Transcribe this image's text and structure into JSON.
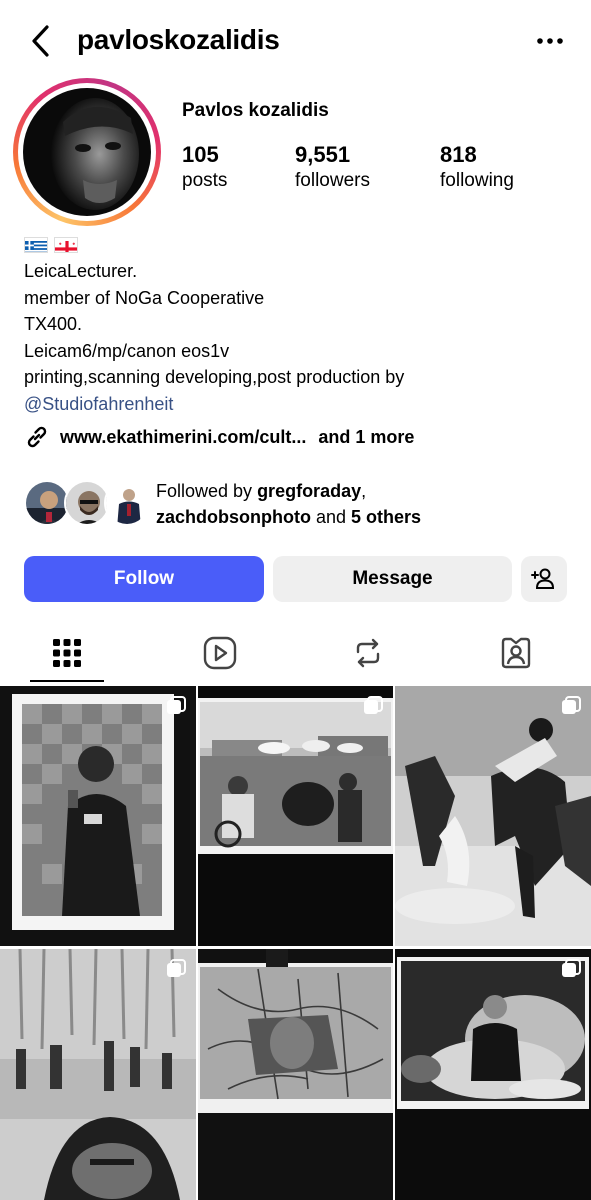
{
  "header": {
    "username": "pavloskozalidis",
    "back_icon": "chevron-left-icon",
    "more_icon": "ellipsis-icon"
  },
  "profile": {
    "display_name": "Pavlos kozalidis",
    "stats": [
      {
        "value": "105",
        "label": "posts"
      },
      {
        "value": "9,551",
        "label": "followers"
      },
      {
        "value": "818",
        "label": "following"
      }
    ]
  },
  "bio": {
    "flags": [
      "greece-flag-icon",
      "georgia-flag-icon"
    ],
    "lines": [
      "LeicaLecturer.",
      "member of NoGa Cooperative",
      "TX400.",
      "Leicam6/mp/canon eos1v",
      "printing,scanning developing,post production by"
    ],
    "mention": "@Studiofahrenheit",
    "link": "www.ekathimerini.com/cult...",
    "link_more": "and 1 more"
  },
  "followed_by": {
    "prefix": "Followed by ",
    "user1": "gregforaday",
    "comma": ",",
    "user2": "zachdobsonphoto",
    "middle": " and ",
    "others": "5 others"
  },
  "actions": {
    "follow": "Follow",
    "message": "Message"
  },
  "tabs": [
    "grid-icon",
    "reels-icon",
    "tagged-reposts-icon",
    "tagged-user-icon"
  ],
  "colors": {
    "follow_button": "#4a5df9",
    "mention": "#385185",
    "secondary_button": "#efefef"
  }
}
